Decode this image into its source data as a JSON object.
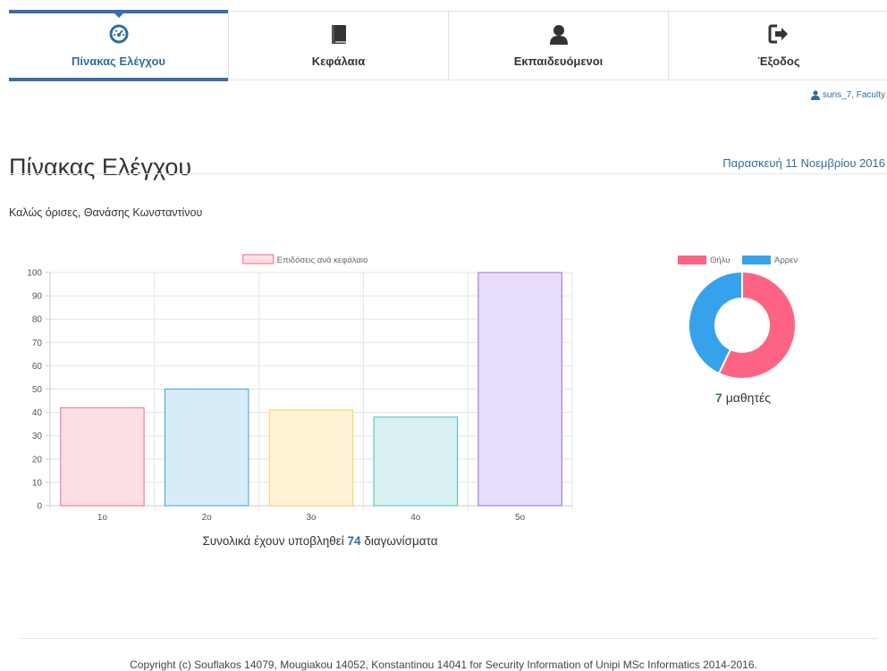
{
  "nav": {
    "tabs": [
      {
        "label": "Πίνακας Ελέγχου",
        "icon": "dashboard-icon",
        "active": true
      },
      {
        "label": "Κεφάλαια",
        "icon": "book-icon",
        "active": false
      },
      {
        "label": "Εκπαιδευόμενοι",
        "icon": "user-icon",
        "active": false
      },
      {
        "label": "Έξοδος",
        "icon": "sign-out-icon",
        "active": false
      }
    ]
  },
  "user": {
    "label": "suns_7, Faculty"
  },
  "page": {
    "title": "Πίνακας Ελέγχου",
    "date": "Παρασκευή 11 Νοεμβρίου 2016",
    "welcome": "Καλώς όρισες, Θανάσης Κωνσταντίνου"
  },
  "bar_caption": {
    "prefix": "Συνολικά έχουν υποβληθεί ",
    "count": "74",
    "suffix": " διαγωνίσματα"
  },
  "students": {
    "count": "7",
    "label": " μαθητές"
  },
  "footer": {
    "text": "Copyright (c) Souflakos 14079, Mougiakou 14052, Konstantinou 14041 for Security Information of Unipi MSc Informatics 2014-2016."
  },
  "colors": {
    "accent": "#3a6ea5",
    "link": "#2f6ca3"
  },
  "chart_data": [
    {
      "type": "bar",
      "categories": [
        "1o",
        "2o",
        "3o",
        "4o",
        "5o"
      ],
      "series": [
        {
          "name": "Επιδόσεις ανά κεφάλαιο",
          "values": [
            42,
            50,
            41,
            38,
            100
          ]
        }
      ],
      "ylim": [
        0,
        100
      ],
      "yticks": [
        0,
        10,
        20,
        30,
        40,
        50,
        60,
        70,
        80,
        90,
        100
      ],
      "legend": "top",
      "grid": true,
      "fills": [
        "#fde0e6",
        "#d8ebf8",
        "#fff3d6",
        "#d9f1f1",
        "#e8dcfd"
      ],
      "strokes": [
        "#ff6384",
        "#36a2eb",
        "#ffce56",
        "#4bc0c0",
        "#9966ff"
      ]
    },
    {
      "type": "pie",
      "variant": "doughnut",
      "labels": [
        "Θήλυ",
        "Άρρεν"
      ],
      "values": [
        4,
        3
      ],
      "colors": [
        "#ff6384",
        "#36a2eb"
      ],
      "legend": "top"
    }
  ]
}
